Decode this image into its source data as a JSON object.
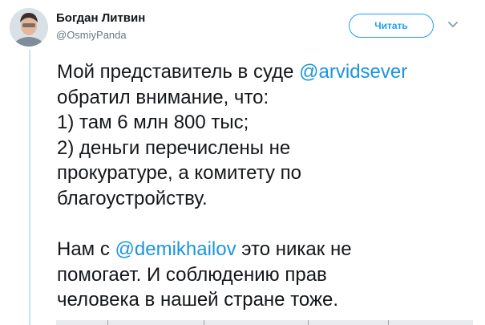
{
  "author": {
    "display_name": "Богдан Литвин",
    "handle": "@OsmiyPanda",
    "avatar_icon": "profile-photo"
  },
  "follow_button": {
    "label": "Читать"
  },
  "menu": {
    "icon": "chevron-down-icon"
  },
  "tweet": {
    "line1_prefix": "Мой представитель в суде ",
    "mention1": "@arvidsever",
    "line2": "обратил внимание, что:",
    "line3": "1) там 6 млн 800 тыс;",
    "line4": "2) деньги перечислены не",
    "line5": "прокуратуре, а комитету по",
    "line6": "благоустройству.",
    "line7_prefix": "Нам с ",
    "mention2": "@demikhailov",
    "line7_suffix": " это никак не",
    "line8": "помогает. И соблюдению прав",
    "line9": "человека в нашей стране тоже."
  },
  "colors": {
    "accent": "#1da1f2",
    "mention": "#1b95e0",
    "text": "#14171a",
    "secondary": "#657786",
    "thread_line": "#c4e3f3"
  }
}
